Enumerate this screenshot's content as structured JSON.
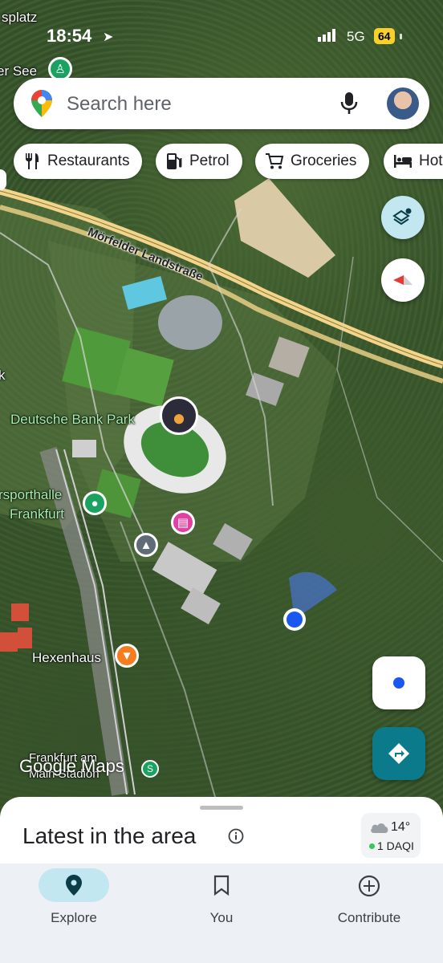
{
  "status_bar": {
    "time": "18:54",
    "network": "5G",
    "battery": "64",
    "battery_color": "#f7d02a"
  },
  "search": {
    "placeholder": "Search here",
    "left_icon": "google-maps-pin-icon",
    "mic_icon": "mic-icon",
    "avatar": "profile-avatar"
  },
  "chips": [
    {
      "label": "Restaurants",
      "icon": "fork-knife-icon"
    },
    {
      "label": "Petrol",
      "icon": "fuel-pump-icon"
    },
    {
      "label": "Groceries",
      "icon": "cart-icon"
    },
    {
      "label": "Hot",
      "icon": "bed-icon"
    }
  ],
  "map": {
    "labels": {
      "top_left_1": "splatz",
      "top_left_2": "er See",
      "road": "Mörfelder Landstraße",
      "stadium": "Deutsche Bank Park",
      "sporthalle_1": "rsporthalle",
      "sporthalle_2": "Frankfurt",
      "hexenhaus": "Hexenhaus",
      "station_1": "Frankfurt am",
      "station_2": "Main Stadion",
      "k_fragment": "k"
    },
    "attribution": "Google Maps",
    "colors": {
      "highway": "#f2d58a",
      "user_location": "#1a56f0",
      "hotel_pin": "#e040a0",
      "bar_pin": "#f57c1f",
      "park_pin": "#1aa260",
      "school_pin": "#5f6b76",
      "directions_button": "#0b7a8a"
    }
  },
  "buttons": {
    "layers": "layers-icon",
    "compass": "compass-icon",
    "my_location": "my-location-icon",
    "directions": "directions-icon"
  },
  "sheet": {
    "title": "Latest in the area",
    "weather_temp": "14°",
    "weather_aqi": "1 DAQI"
  },
  "nav": {
    "items": [
      {
        "label": "Explore",
        "icon": "explore-pin-icon",
        "active": true
      },
      {
        "label": "You",
        "icon": "bookmark-icon",
        "active": false
      },
      {
        "label": "Contribute",
        "icon": "add-circle-icon",
        "active": false
      }
    ],
    "active_color": "#c2e7f0"
  }
}
